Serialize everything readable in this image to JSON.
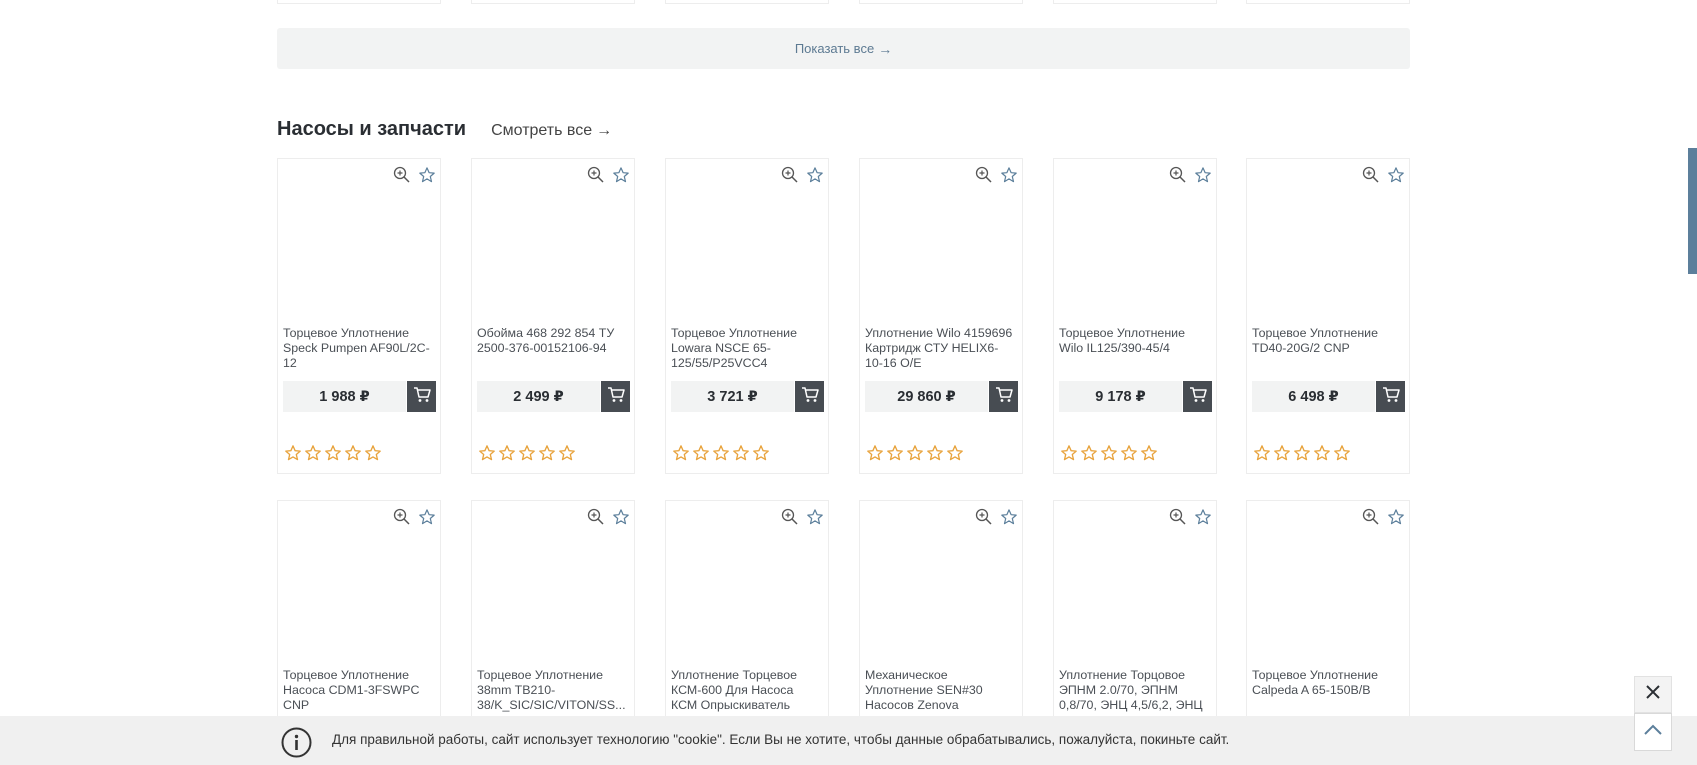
{
  "show_all": {
    "label": "Показать все",
    "arrow": "→"
  },
  "section": {
    "title": "Насосы и запчасти",
    "see_all": "Смотреть все",
    "arrow": "→"
  },
  "products_row1": [
    {
      "name": "Торцевое Уплотнение Speck Pumpen AF90L/2C-12",
      "price": "1 988 ₽"
    },
    {
      "name": "Обойма 468 292 854 ТУ 2500-376-00152106-94",
      "price": "2 499 ₽"
    },
    {
      "name": "Торцевое Уплотнение Lowara NSCE 65-125/55/P25VCC4",
      "price": "3 721 ₽"
    },
    {
      "name": "Уплотнение Wilo 4159696 Картридж СТУ HELIX6-10-16 O/E",
      "price": "29 860 ₽"
    },
    {
      "name": "Торцевое Уплотнение Wilo IL125/390-45/4",
      "price": "9 178 ₽"
    },
    {
      "name": "Торцевое Уплотнение TD40-20G/2 CNP",
      "price": "6 498 ₽"
    }
  ],
  "products_row2": [
    {
      "name": "Торцевое Уплотнение Насоса CDM1-3FSWPC CNP"
    },
    {
      "name": "Торцевое Уплотнение 38mm TB210-38/K_SIC/SIC/VITON/SS..."
    },
    {
      "name": "Уплотнение Торцевое КСМ-600 Для Насоса КСМ Опрыскиватель"
    },
    {
      "name": "Механическое Уплотнение SEN#30 Насосов Zenova"
    },
    {
      "name": "Уплотнение Торцовое ЭПНМ 2.0/70, ЭПНМ 0,8/70, ЭНЦ 4,5/6,2, ЭНЦ"
    },
    {
      "name": "Торцевое Уплотнение Calpeda A 65-150B/B"
    }
  ],
  "rating": {
    "stars": 5,
    "filled": 0,
    "color": "#e8a33d"
  },
  "icons": {
    "zoom": "zoom-in-icon",
    "favorite": "star-icon",
    "cart": "cart-icon",
    "info": "info-icon",
    "close": "close-icon",
    "up": "chevron-up-icon"
  },
  "colors": {
    "accent": "#5c7f9b",
    "cart_button": "#474c52",
    "price_bg": "#f2f3f3",
    "star": "#e8a33d"
  },
  "cookie": {
    "text": "Для правильной работы, сайт использует технологию \"cookie\". Если Вы не хотите, чтобы данные обрабатывались, пожалуйста, покиньте сайт."
  }
}
